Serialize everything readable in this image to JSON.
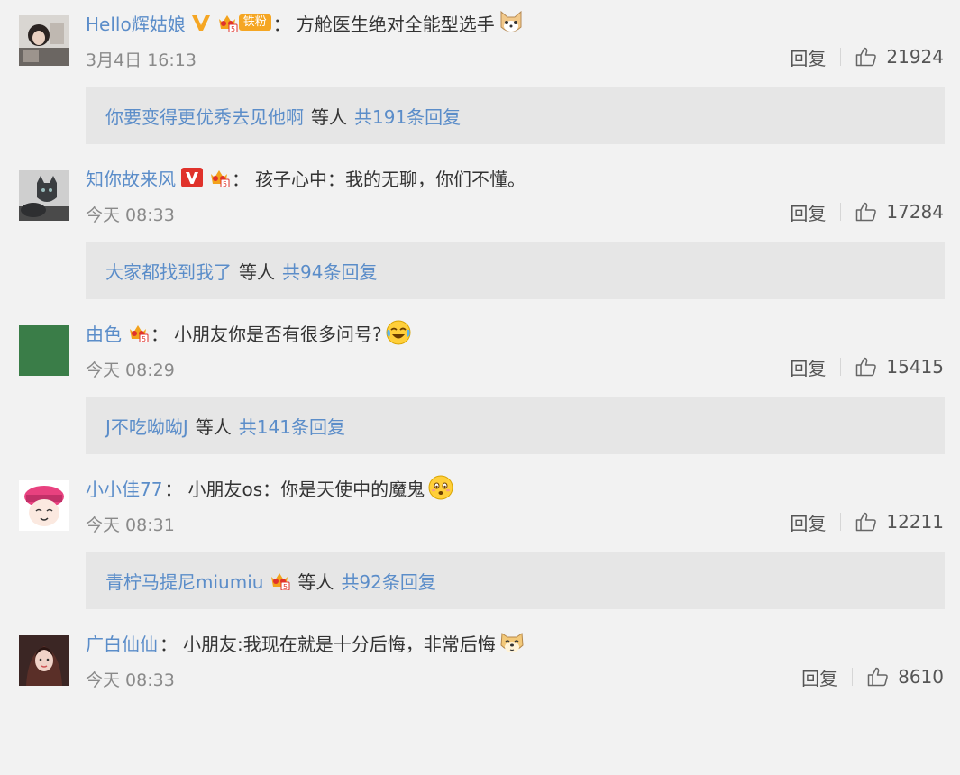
{
  "colors": {
    "link": "#5b8dc9",
    "text": "#333333",
    "muted": "#8a8a8a",
    "reply_bg": "#e6e6e6",
    "page_bg": "#f2f2f2",
    "verified_gold": "#f5a623",
    "verified_red": "#e0322b"
  },
  "comments": [
    {
      "username": "Hello辉姑娘",
      "colon": "：",
      "text": "方舱医生绝对全能型选手",
      "badges": [
        "gold-v-icon",
        "crown-level-icon",
        "fan-badge"
      ],
      "fan_badge_text": "铁粉",
      "emoji": "cat-face-emoji",
      "time": "3月4日 16:13",
      "reply_label": "回复",
      "likes": "21924",
      "reply_preview": {
        "users": "你要变得更优秀去见他啊",
        "suffix": "等人",
        "total": "共191条回复"
      }
    },
    {
      "username": "知你故来风",
      "colon": "：",
      "text": "孩子心中：我的无聊，你们不懂。",
      "badges": [
        "red-v-icon",
        "crown-level-icon"
      ],
      "time": "今天 08:33",
      "reply_label": "回复",
      "likes": "17284",
      "reply_preview": {
        "users": "大家都找到我了",
        "suffix": "等人",
        "total": "共94条回复"
      }
    },
    {
      "username": "由色",
      "colon": "：",
      "text": "小朋友你是否有很多问号?",
      "badges": [
        "crown-level-icon"
      ],
      "emoji": "laugh-cry-emoji",
      "time": "今天 08:29",
      "reply_label": "回复",
      "likes": "15415",
      "reply_preview": {
        "users": "J不吃呦呦J",
        "suffix": "等人",
        "total": "共141条回复"
      }
    },
    {
      "username": "小小佳77",
      "colon": "：",
      "text": "小朋友os：你是天使中的魔鬼",
      "emoji": "worried-face-emoji",
      "time": "今天 08:31",
      "reply_label": "回复",
      "likes": "12211",
      "reply_preview": {
        "users": "青柠马提尼miumiu",
        "suffix": "等人",
        "total": "共92条回复",
        "badge": "crown-level-icon"
      }
    },
    {
      "username": "广白仙仙",
      "colon": "：",
      "text": "小朋友:我现在就是十分后悔，非常后悔",
      "emoji": "doge-emoji",
      "time": "今天 08:33",
      "reply_label": "回复",
      "likes": "8610"
    }
  ]
}
